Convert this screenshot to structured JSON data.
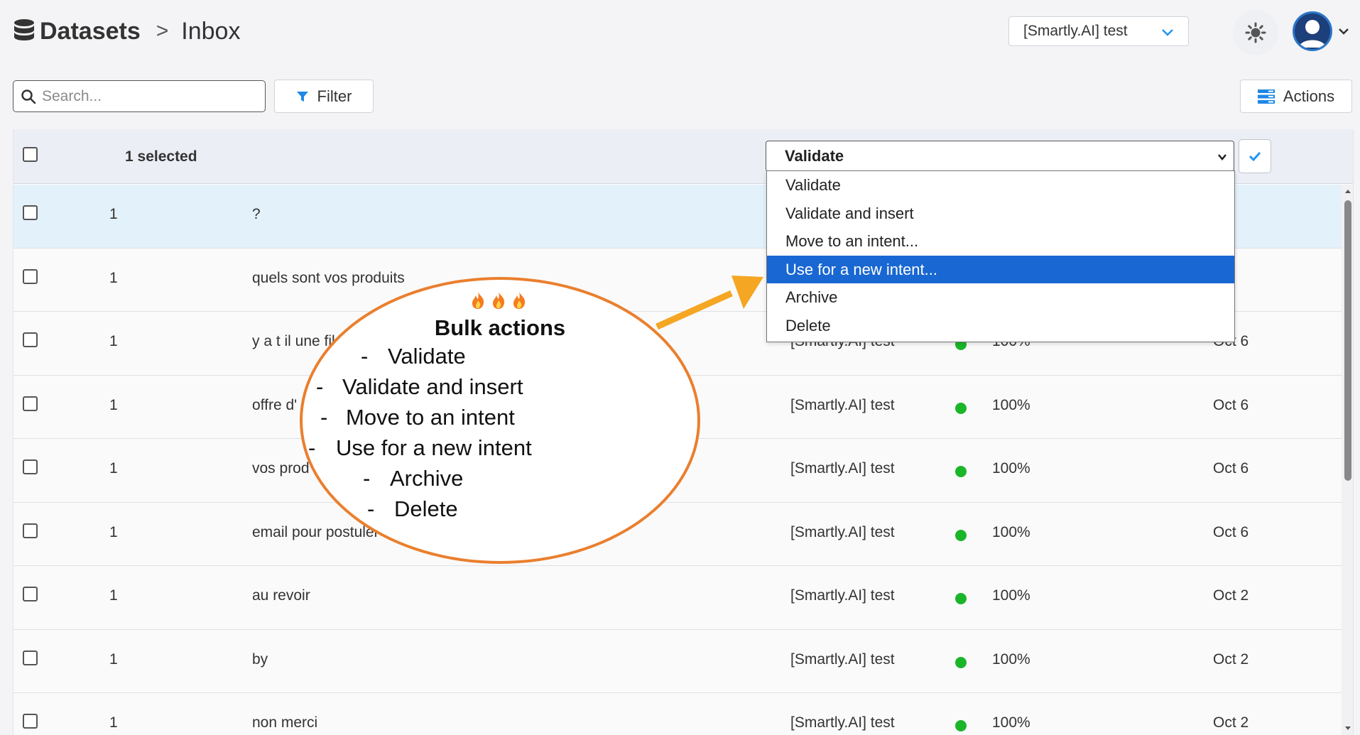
{
  "header": {
    "breadcrumb_root": "Datasets",
    "breadcrumb_sep": ">",
    "breadcrumb_current": "Inbox",
    "workspace": "[Smartly.AI] test",
    "icons": [
      "database-icon",
      "chevron-down-icon",
      "sun-icon",
      "user-avatar",
      "chevron-down-icon"
    ]
  },
  "toolbar": {
    "search_placeholder": "Search...",
    "filter_label": "Filter",
    "actions_label": "Actions"
  },
  "bulk": {
    "selected_label": "1 selected",
    "selected_action": "Validate",
    "options": [
      "Validate",
      "Validate and insert",
      "Move to an intent...",
      "Use for a new intent...",
      "Archive",
      "Delete"
    ],
    "highlighted_index": 3
  },
  "rows": [
    {
      "count": "1",
      "text": "?",
      "project": "",
      "confidence": "",
      "date": "",
      "highlighted": true
    },
    {
      "count": "1",
      "text": "quels sont vos produits",
      "project": "",
      "confidence": "",
      "date": "t 8"
    },
    {
      "count": "1",
      "text": "y a t il une fil",
      "project": "[Smartly.AI] test",
      "confidence": "100%",
      "date": "Oct 6"
    },
    {
      "count": "1",
      "text": "offre d'",
      "project": "[Smartly.AI] test",
      "confidence": "100%",
      "date": "Oct 6"
    },
    {
      "count": "1",
      "text": "vos prod",
      "project": "[Smartly.AI] test",
      "confidence": "100%",
      "date": "Oct 6"
    },
    {
      "count": "1",
      "text": "email pour postuler",
      "project": "[Smartly.AI] test",
      "confidence": "100%",
      "date": "Oct 6"
    },
    {
      "count": "1",
      "text": "au revoir",
      "project": "[Smartly.AI] test",
      "confidence": "100%",
      "date": "Oct 2"
    },
    {
      "count": "1",
      "text": "by",
      "project": "[Smartly.AI] test",
      "confidence": "100%",
      "date": "Oct 2"
    },
    {
      "count": "1",
      "text": "non merci",
      "project": "[Smartly.AI] test",
      "confidence": "100%",
      "date": "Oct 2"
    }
  ],
  "callout": {
    "title": "Bulk actions",
    "dash": "-",
    "items": [
      "Validate",
      "Validate and insert",
      "Move to an intent",
      "Use for a new intent",
      "Archive",
      "Delete"
    ],
    "border_color": "#ea7f2e",
    "arrow_color": "#f5a623"
  },
  "colors": {
    "highlight_row": "#e3f1fb",
    "selected_option": "#1967d2",
    "status_dot": "#1bb52a",
    "accent": "#2196f3"
  }
}
